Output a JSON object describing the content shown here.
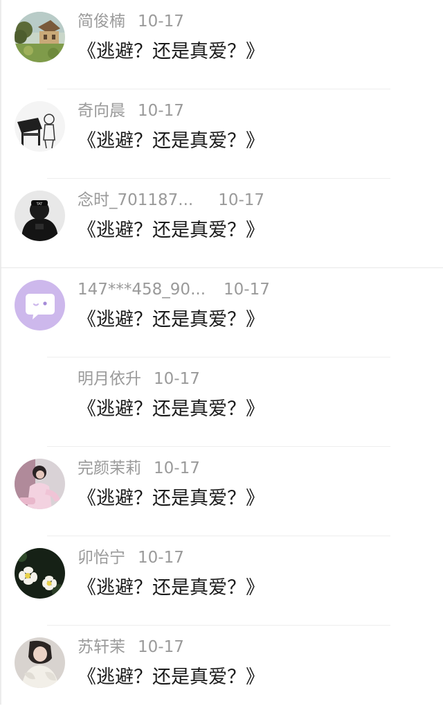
{
  "comments": [
    {
      "user": "简俊楠",
      "time": "10-17",
      "text": "《逃避？还是真爱？》",
      "avatar_icon": "cottage-painting-avatar"
    },
    {
      "user": "奇向晨",
      "time": "10-17",
      "text": "《逃避？还是真爱？》",
      "avatar_icon": "piano-sketch-avatar"
    },
    {
      "user": "念时_701187...",
      "time": "10-17",
      "text": "《逃避？还是真爱？》",
      "avatar_icon": "hooded-figure-avatar"
    },
    {
      "user": "147***458_90...",
      "time": "10-17",
      "text": "《逃避？还是真爱？》",
      "avatar_icon": "chat-bubble-default-avatar"
    },
    {
      "user": "明月依升",
      "time": "10-17",
      "text": "《逃避？还是真爱？》",
      "avatar_icon": "blank-avatar"
    },
    {
      "user": "完颜茉莉",
      "time": "10-17",
      "text": "《逃避？还是真爱？》",
      "avatar_icon": "girl-photo-avatar"
    },
    {
      "user": "卯怡宁",
      "time": "10-17",
      "text": "《逃避？还是真爱？》",
      "avatar_icon": "white-flowers-avatar"
    },
    {
      "user": "苏轩茉",
      "time": "10-17",
      "text": "《逃避？还是真爱？》",
      "avatar_icon": "girl-knit-avatar"
    }
  ],
  "colors": {
    "username": "#9a9a9a",
    "comment_text": "#1b1b1b",
    "divider": "#eeeeee",
    "default_avatar_bg": "#cdb8ec"
  }
}
